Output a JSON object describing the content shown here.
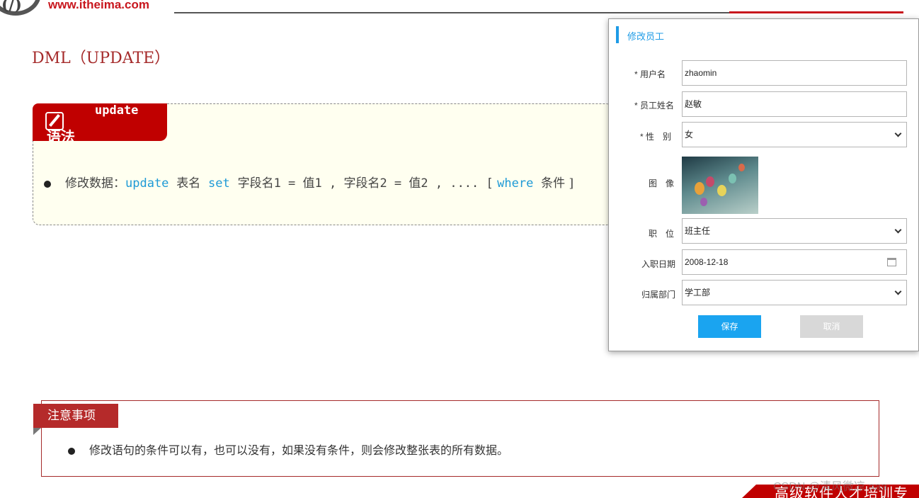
{
  "header": {
    "logo_mark": "(/)",
    "logo_url": "www.itheima.com"
  },
  "slide": {
    "title": "DML（UPDATE）"
  },
  "syntax": {
    "tag_keyword": "update",
    "tag_label": "语法",
    "prefix": "修改数据：",
    "kw_update": "update",
    "table_name": "表名",
    "kw_set": "set",
    "assignments": "字段名1 = 值1 , 字段名2 = 值2 , .... [",
    "kw_where": "where",
    "condition": "条件 ]"
  },
  "dialog": {
    "title": "修改员工",
    "fields": {
      "username": {
        "label": "* 用户名",
        "value": "zhaomin"
      },
      "name": {
        "label": "* 员工姓名",
        "value": "赵敏"
      },
      "gender": {
        "label": "* 性　别",
        "value": "女"
      },
      "image": {
        "label": "图　像"
      },
      "position": {
        "label": "职　位",
        "value": "班主任"
      },
      "entry_date": {
        "label": "入职日期",
        "value": "2008-12-18"
      },
      "department": {
        "label": "归属部门",
        "value": "学工部"
      }
    },
    "save_label": "保存",
    "cancel_label": "取消"
  },
  "notice": {
    "tag": "注意事项",
    "text": "修改语句的条件可以有，也可以没有，如果没有条件，则会修改整张表的所有数据。"
  },
  "footer": {
    "slogan": "高级软件人才培训专",
    "watermark": "CSDN @清风微凉 aaa"
  },
  "colors": {
    "brand_red": "#c00000",
    "accent_blue": "#1aa4f0",
    "syntax_bg": "#fffff0"
  }
}
